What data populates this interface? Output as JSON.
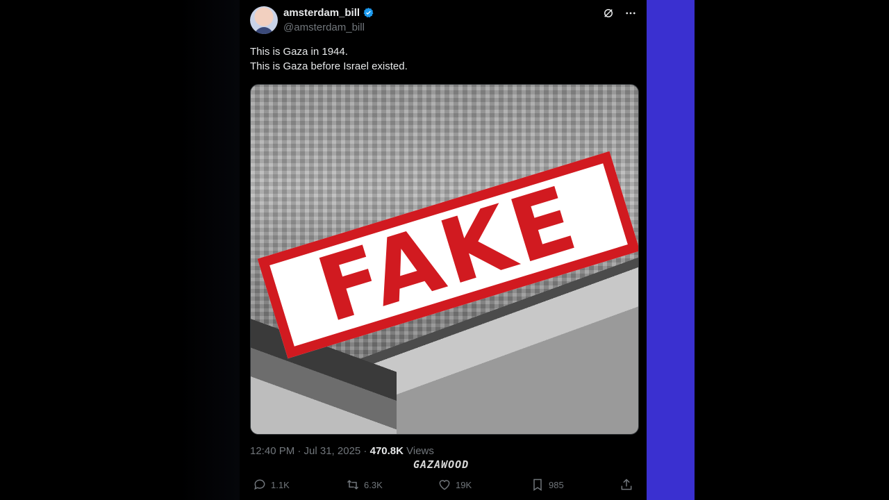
{
  "author": {
    "display_name": "amsterdam_bill",
    "handle": "@amsterdam_bill"
  },
  "post": {
    "text_line1": "This is Gaza in 1944.",
    "text_line2": "This is Gaza before Israel existed.",
    "stamp_text": "FAKE",
    "timestamp": "12:40 PM · Jul 31, 2025 · ",
    "views_count": "470.8K",
    "views_label": " Views"
  },
  "watermark": "GAZAWOOD",
  "actions": {
    "replies": "1.1K",
    "reposts": "6.3K",
    "likes": "19K",
    "bookmarks": "985"
  },
  "colors": {
    "background": "#000000",
    "text": "#e7e9ea",
    "muted": "#71767b",
    "verified": "#1d9bf0",
    "stamp_red": "#d11a20",
    "side_band": "#3a30d0"
  },
  "icons": [
    "verified-badge-icon",
    "grok-icon",
    "more-icon",
    "reply-icon",
    "repost-icon",
    "like-icon",
    "bookmark-icon",
    "share-icon"
  ]
}
